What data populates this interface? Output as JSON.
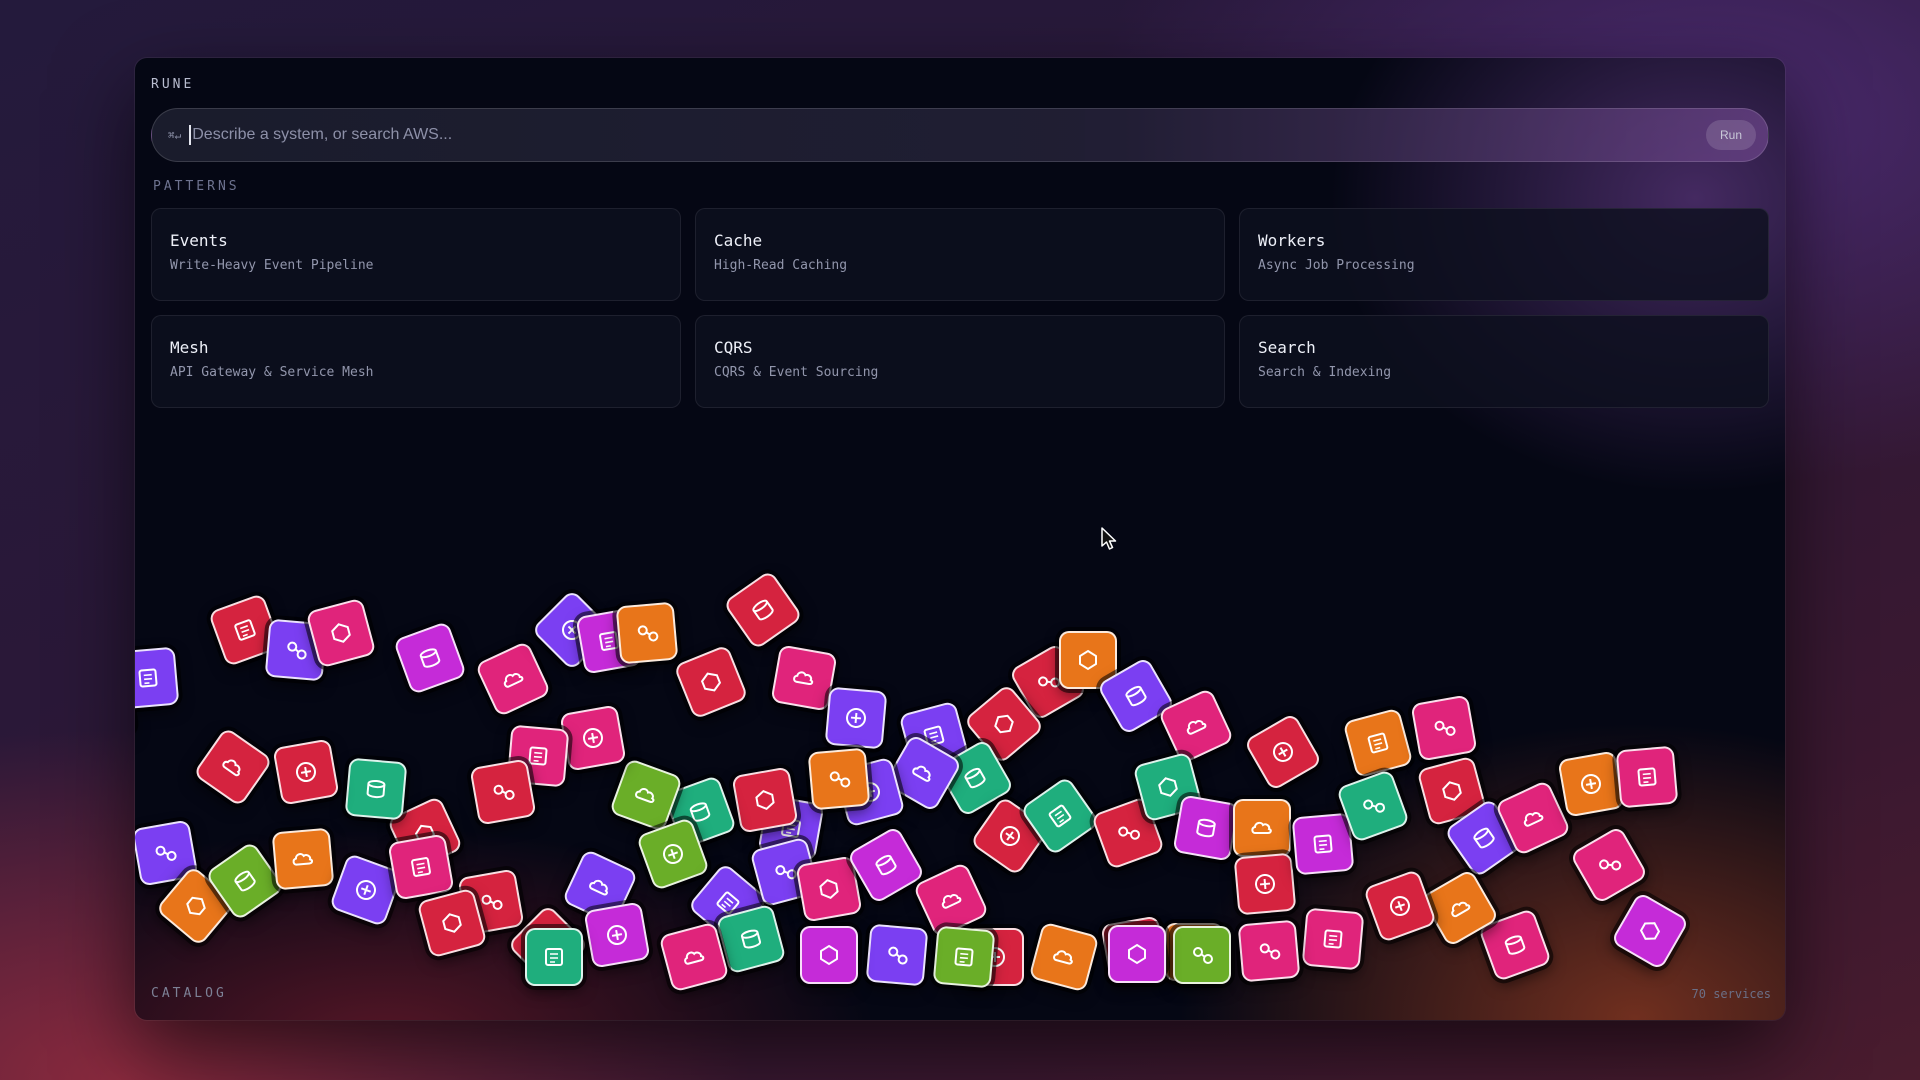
{
  "app": {
    "title": "RUNE"
  },
  "search": {
    "shortcut": "⌘↵",
    "placeholder": "Describe a system, or search AWS...",
    "value": "",
    "run_label": "Run"
  },
  "patterns": {
    "label": "PATTERNS",
    "items": [
      {
        "title": "Events",
        "subtitle": "Write-Heavy Event Pipeline"
      },
      {
        "title": "Cache",
        "subtitle": "High-Read Caching"
      },
      {
        "title": "Workers",
        "subtitle": "Async Job Processing"
      },
      {
        "title": "Mesh",
        "subtitle": "API Gateway & Service Mesh"
      },
      {
        "title": "CQRS",
        "subtitle": "CQRS & Event Sourcing"
      },
      {
        "title": "Search",
        "subtitle": "Search & Indexing"
      }
    ]
  },
  "catalog": {
    "label": "CATALOG",
    "count": "70 services"
  },
  "colors": {
    "red": "#d5233f",
    "pink": "#e0247b",
    "purple": "#7b3ff2",
    "green": "#1fae7d",
    "lime": "#6aae28",
    "orange": "#e8751a",
    "magenta": "#c52bd8"
  },
  "service_icons": [
    "aws-service-icon"
  ]
}
